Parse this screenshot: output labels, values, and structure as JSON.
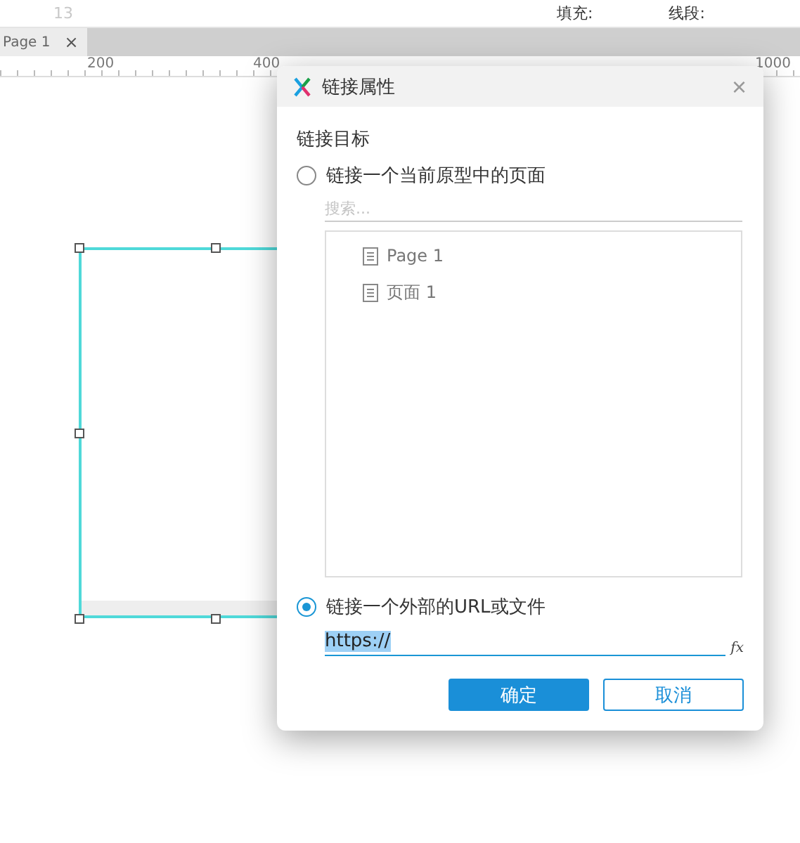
{
  "toolbar": {
    "font_size": "13",
    "fill_label": "填充:",
    "stroke_label": "线段:"
  },
  "tabs": [
    {
      "label": "Page 1",
      "close": "×",
      "selected": true
    }
  ],
  "ruler": {
    "labels": [
      "200",
      "400",
      "1000"
    ]
  },
  "dialog": {
    "title": "链接属性",
    "close": "×",
    "section": "链接目标",
    "options": [
      {
        "kind": "pages",
        "label": "链接一个当前原型中的页面",
        "selected": false,
        "search": {
          "placeholder": "搜索..."
        },
        "pages": [
          "Page 1",
          "页面 1"
        ]
      },
      {
        "kind": "url",
        "label": "链接一个外部的URL或文件",
        "selected": true,
        "url": {
          "value": "https://"
        },
        "fx": "fx"
      }
    ],
    "buttons": [
      {
        "label": "确定",
        "primary": true
      },
      {
        "label": "取消",
        "primary": false
      }
    ]
  }
}
